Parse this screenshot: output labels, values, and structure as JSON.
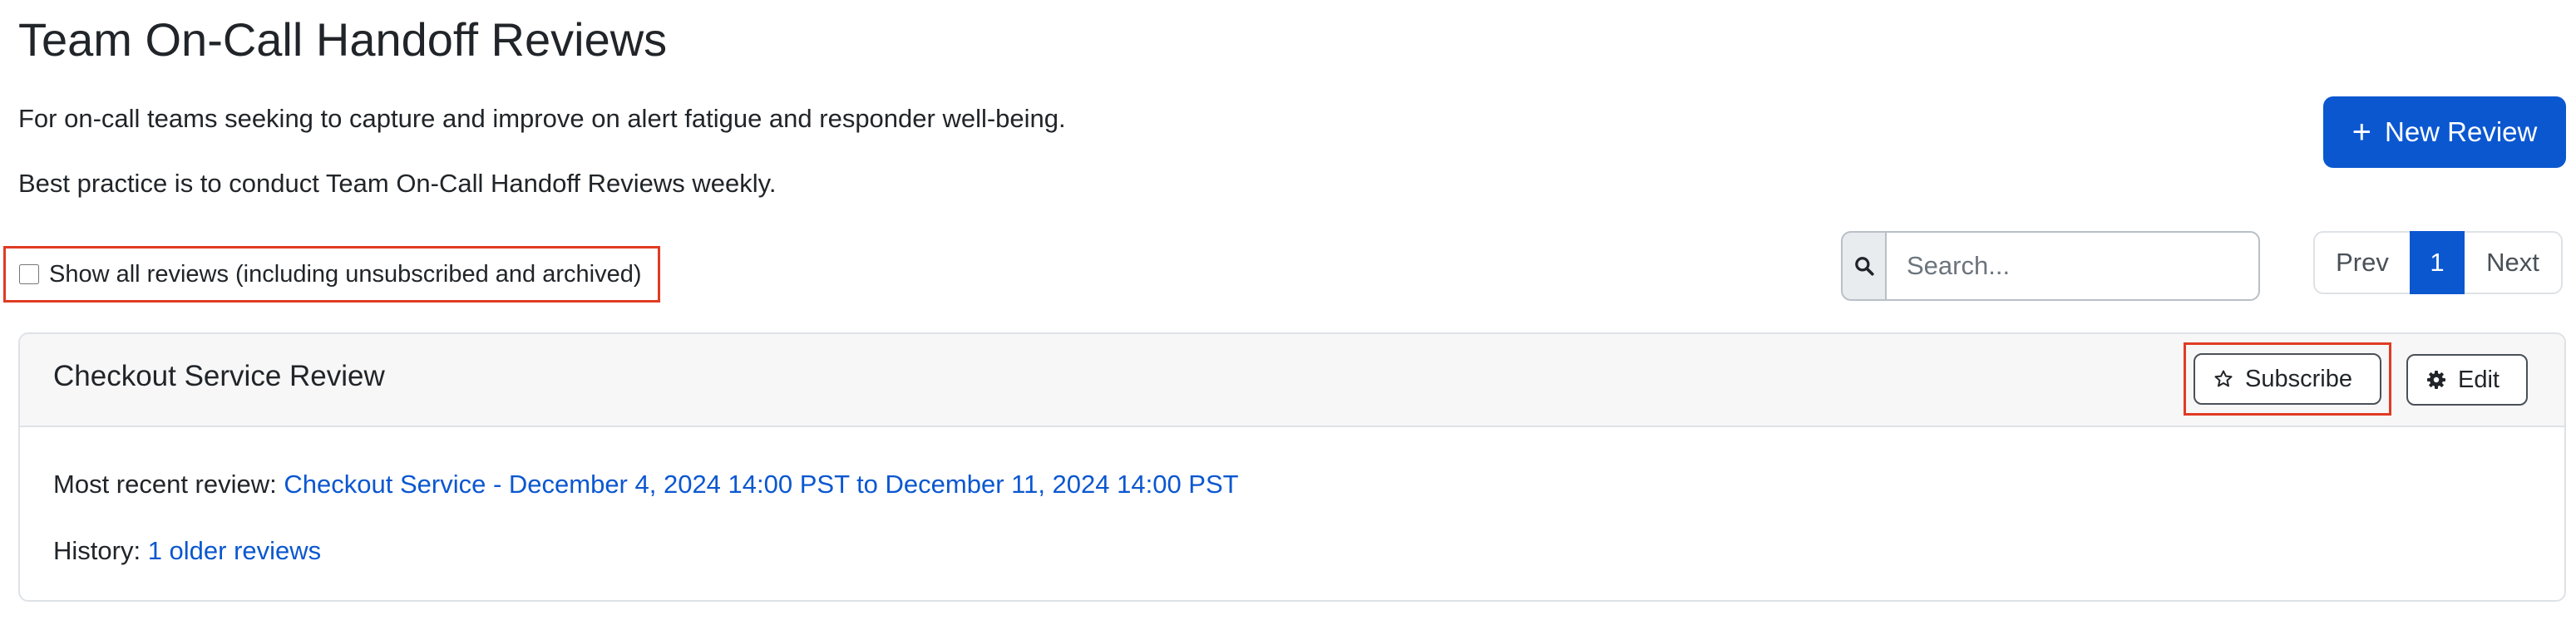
{
  "page": {
    "title": "Team On-Call Handoff Reviews",
    "description_1": "For on-call teams seeking to capture and improve on alert fatigue and responder well-being.",
    "description_2": "Best practice is to conduct Team On-Call Handoff Reviews weekly."
  },
  "toolbar": {
    "new_review_label": "New Review",
    "show_all_label": "Show all reviews (including unsubscribed and archived)",
    "show_all_checked": false,
    "search_placeholder": "Search...",
    "search_value": ""
  },
  "pagination": {
    "prev_label": "Prev",
    "current_page": "1",
    "next_label": "Next"
  },
  "reviews": [
    {
      "name": "Checkout Service Review",
      "subscribe_label": "Subscribe",
      "edit_label": "Edit",
      "recent_prefix": "Most recent review:",
      "recent_link": "Checkout Service - December 4, 2024 14:00 PST to December 11, 2024 14:00 PST",
      "history_prefix": "History:",
      "history_link": "1 older reviews"
    }
  ],
  "icons": {
    "new_review": "plus-icon",
    "search": "search-icon",
    "subscribe": "star-icon",
    "edit": "gear-icon"
  },
  "colors": {
    "primary": "#0b57d0",
    "highlight": "#e03b24",
    "text": "#212529"
  }
}
